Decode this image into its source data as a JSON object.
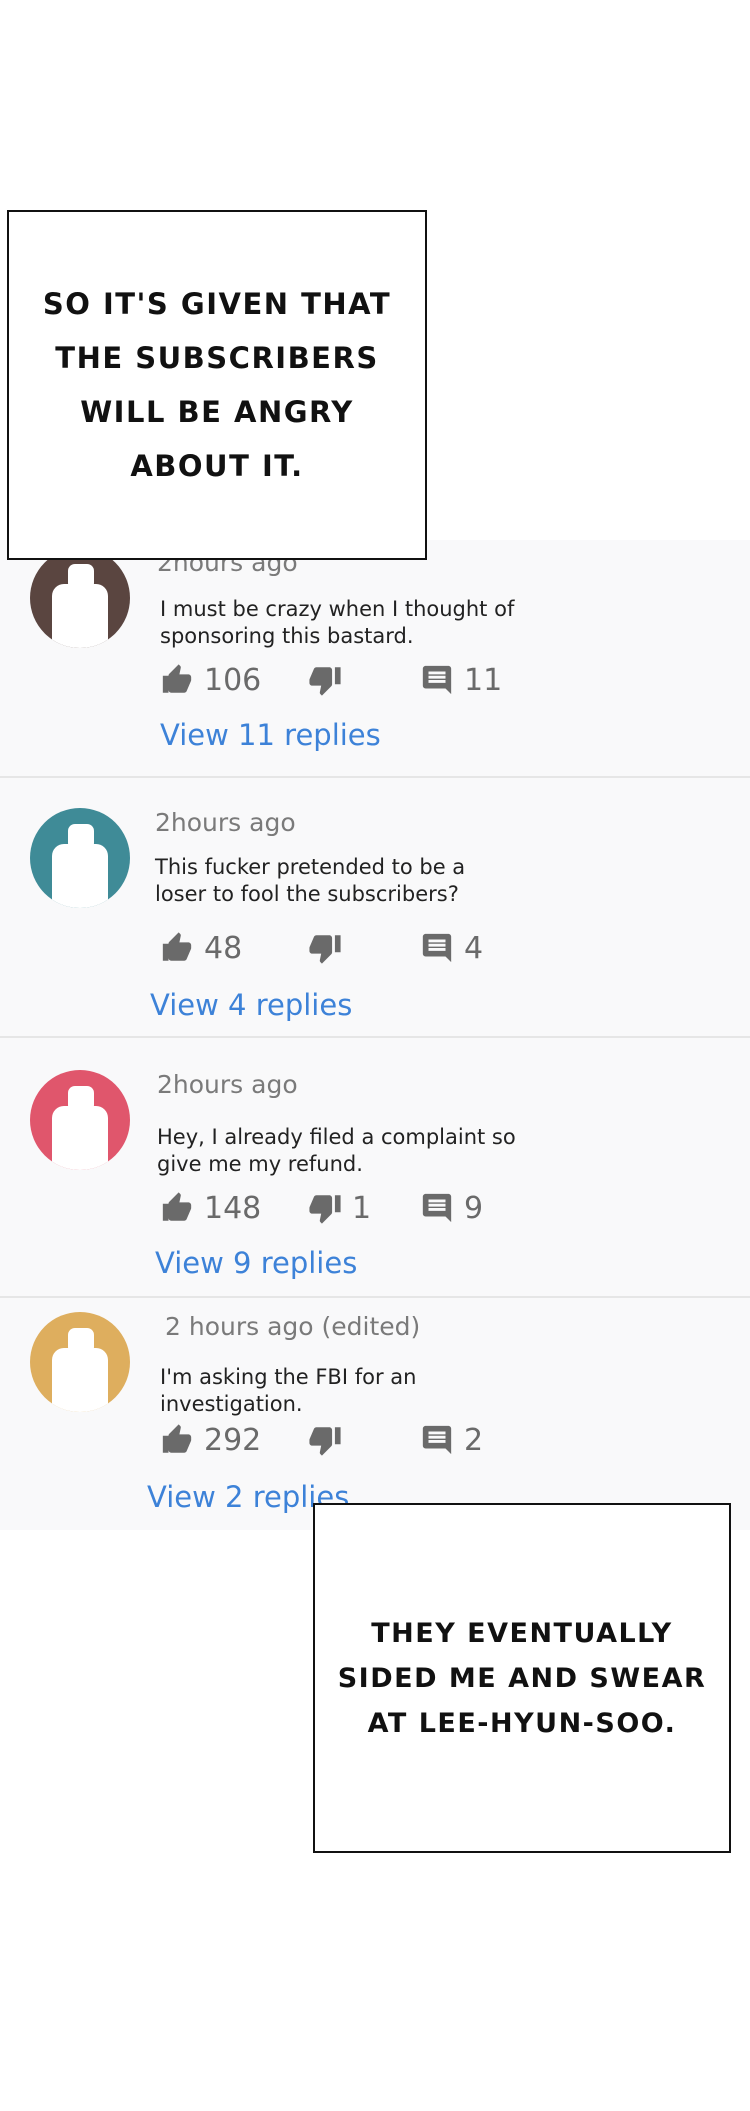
{
  "captions": {
    "top": "SO IT'S GIVEN THAT\nTHE SUBSCRIBERS\nWILL BE ANGRY\nABOUT IT.",
    "bottom": "THEY EVENTUALLY\nSIDED ME AND SWEAR\nAT LEE-HYUN-SOO."
  },
  "comments": [
    {
      "time": "2hours ago",
      "text": "I must be crazy when I thought of sponsoring this bastard.",
      "likes": "106",
      "dislikes": "",
      "reply_count": "11",
      "view_replies": "View 11 replies",
      "avatar_color": "#5a4540"
    },
    {
      "time": "2hours ago",
      "text": "This fucker pretended to be a loser to fool the subscribers?",
      "likes": "48",
      "dislikes": "",
      "reply_count": "4",
      "view_replies": "View 4 replies",
      "avatar_color": "#3f8b97"
    },
    {
      "time": "2hours ago",
      "text": "Hey, I already filed a complaint so give me my refund.",
      "likes": "148",
      "dislikes": "1",
      "reply_count": "9",
      "view_replies": "View 9 replies",
      "avatar_color": "#e0566c"
    },
    {
      "time": "2 hours ago (edited)",
      "text": "I'm asking the FBI for an investigation.",
      "likes": "292",
      "dislikes": "",
      "reply_count": "2",
      "view_replies": "View 2 replies",
      "avatar_color": "#deae5e"
    }
  ],
  "icons": {
    "like": "thumbs-up-icon",
    "dislike": "thumbs-down-icon",
    "reply": "comment-icon"
  }
}
